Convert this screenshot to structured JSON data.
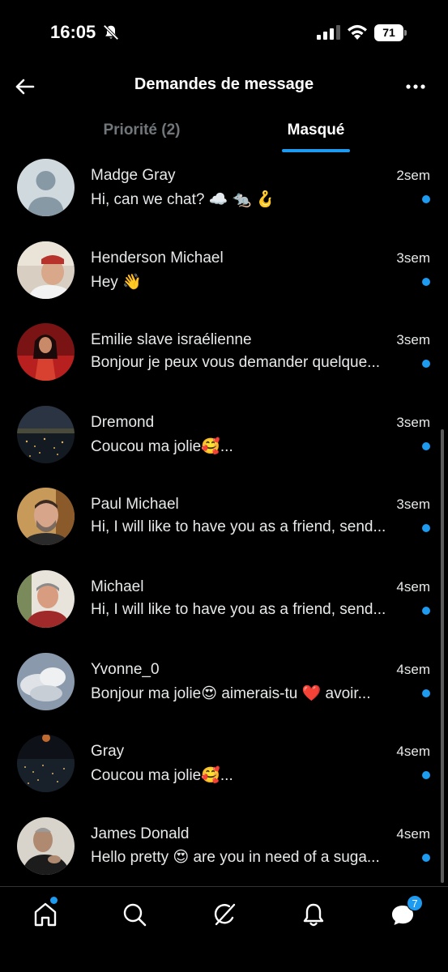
{
  "status_bar": {
    "time": "16:05",
    "battery": "71",
    "icons": [
      "bell-slash-icon",
      "signal-icon",
      "wifi-icon",
      "battery-icon"
    ]
  },
  "header": {
    "title": "Demandes de message",
    "back_icon": "arrow-left-icon",
    "more_icon": "more-horizontal-icon"
  },
  "tabs": [
    {
      "label": "Priorité (2)",
      "active": false
    },
    {
      "label": "Masqué",
      "active": true
    }
  ],
  "conversations": [
    {
      "name": "Madge Gray",
      "time": "2sem",
      "preview": "Hi, can we chat? ☁️ 🐀 🪝",
      "unread": true,
      "avatar": "default-avatar"
    },
    {
      "name": "Henderson Michael",
      "time": "3sem",
      "preview": "Hey 👋",
      "unread": true,
      "avatar": "photo-avatar"
    },
    {
      "name": "Emilie slave israélienne",
      "time": "3sem",
      "preview": "Bonjour je peux vous demander quelque...",
      "unread": true,
      "avatar": "photo-avatar"
    },
    {
      "name": "Dremond",
      "time": "3sem",
      "preview": "Coucou ma jolie🥰...",
      "unread": true,
      "avatar": "photo-avatar"
    },
    {
      "name": "Paul Michael",
      "time": "3sem",
      "preview": "Hi, I will like to have you as a friend, send...",
      "unread": true,
      "avatar": "photo-avatar"
    },
    {
      "name": "Michael",
      "time": "4sem",
      "preview": "Hi, I will like to have you as a friend, send...",
      "unread": true,
      "avatar": "photo-avatar"
    },
    {
      "name": "Yvonne_0",
      "time": "4sem",
      "preview": "Bonjour ma jolie😍 aimerais-tu ❤️ avoir...",
      "unread": true,
      "avatar": "photo-avatar"
    },
    {
      "name": "Gray",
      "time": "4sem",
      "preview": "Coucou ma jolie🥰...",
      "unread": true,
      "avatar": "photo-avatar"
    },
    {
      "name": "James Donald",
      "time": "4sem",
      "preview": "Hello pretty 😍 are you in need of a suga...",
      "unread": true,
      "avatar": "photo-avatar"
    }
  ],
  "bottom_nav": {
    "items": [
      "home-icon",
      "search-icon",
      "grok-icon",
      "notifications-icon",
      "messages-icon"
    ],
    "messages_badge": "7"
  },
  "colors": {
    "accent": "#1d9bf0",
    "background": "#000000",
    "secondary_text": "#71767b"
  }
}
